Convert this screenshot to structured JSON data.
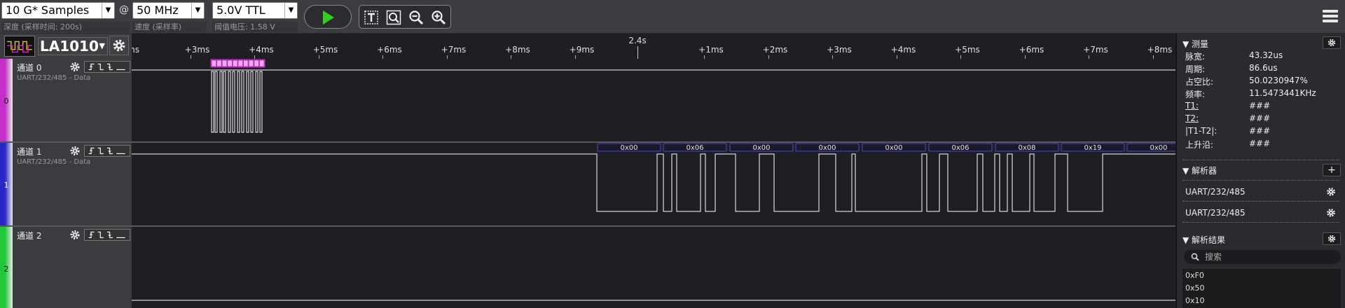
{
  "toolbar": {
    "samples": "10 G* Samples",
    "at": "@",
    "rate": "50 MHz",
    "voltage": "5.0V TTL",
    "depth_label": "深度 (采样时间: 200s)",
    "rate_label": "速度 (采样率)",
    "voltage_label": "阈值电压: 1.58 V"
  },
  "device": {
    "name": "LA1010"
  },
  "axis": {
    "center_label": "2.4s",
    "left_ticks": [
      "ms",
      "+3ms",
      "+4ms",
      "+5ms",
      "+6ms",
      "+7ms",
      "+8ms",
      "+9ms"
    ],
    "right_ticks": [
      "+1ms",
      "+2ms",
      "+3ms",
      "+4ms",
      "+5ms",
      "+6ms",
      "+7ms",
      "+8ms"
    ]
  },
  "channels": [
    {
      "num": "0",
      "name": "通道 0",
      "proto": "UART/232/485 - Data",
      "color": "#c42fc8"
    },
    {
      "num": "1",
      "name": "通道 1",
      "proto": "UART/232/485 - Data",
      "color": "#2727c8"
    },
    {
      "num": "2",
      "name": "通道 2",
      "proto": "",
      "color": "#22c83a"
    }
  ],
  "decode_labels": [
    "0x00",
    "0x06",
    "0x00",
    "0x00",
    "0x00",
    "0x06",
    "0x08",
    "0x19",
    "0x00"
  ],
  "panel": {
    "measure_title": "测量",
    "measurements": [
      {
        "label": "脉宽:",
        "value": "43.32us"
      },
      {
        "label": "周期:",
        "value": "86.6us"
      },
      {
        "label": "占空比:",
        "value": "50.0230947%"
      },
      {
        "label": "频率:",
        "value": "11.5473441KHz"
      },
      {
        "label": "T1:",
        "value": "###"
      },
      {
        "label": "T2:",
        "value": "###"
      },
      {
        "label": "|T1-T2|:",
        "value": "###"
      },
      {
        "label": "上升沿:",
        "value": "###"
      }
    ],
    "analyzer_title": "解析器",
    "analyzers": [
      "UART/232/485",
      "UART/232/485"
    ],
    "results_title": "解析结果",
    "search_placeholder": "搜索",
    "results": [
      "0xF0",
      "0x50",
      "0x10"
    ]
  },
  "colors": {
    "ch0": "#c42fc8",
    "ch1": "#2727c8",
    "ch2": "#22c83a",
    "run": "#2fd21a"
  }
}
